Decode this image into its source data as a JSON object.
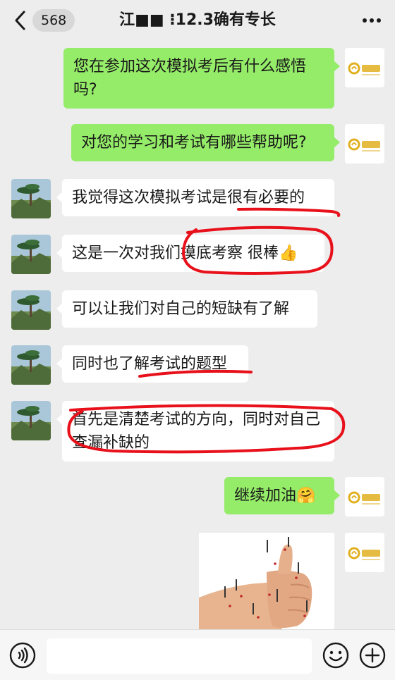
{
  "header": {
    "back_icon": "chevron-left-icon",
    "unread_count": "568",
    "title": "江■■ ⁝12.3确有专长",
    "more_icon": "ellipsis-icon"
  },
  "avatar_me": {
    "icon": "logo-avatar-icon",
    "brand_text": "金华阳"
  },
  "messages": [
    {
      "side": "me",
      "text": "您在参加这次模拟考后有什么感悟吗?"
    },
    {
      "side": "me",
      "text": "对您的学习和考试有哪些帮助呢?"
    },
    {
      "side": "them",
      "text": "我觉得这次模拟考试是很有必要的"
    },
    {
      "side": "them",
      "text": "这是一次对我们摸底考察 很棒👍"
    },
    {
      "side": "them",
      "text": "可以让我们对自己的短缺有了解"
    },
    {
      "side": "them",
      "text": "同时也了解考试的题型"
    },
    {
      "side": "them",
      "text": "首先是清楚考试的方向，同时对自己查漏补缺的"
    },
    {
      "side": "me",
      "text": "继续加油🤗"
    }
  ],
  "image_message": {
    "description_icon": "thumbs-up-hand-photo"
  },
  "bottombar": {
    "voice_icon": "voice-icon",
    "input_value": "",
    "emoji_icon": "emoji-icon",
    "plus_icon": "plus-circle-icon"
  },
  "colors": {
    "background": "#ededed",
    "bubble_me": "#95ec69",
    "bubble_them": "#ffffff",
    "annotation_red": "#e8101a",
    "brand_gold": "#e0b020"
  }
}
